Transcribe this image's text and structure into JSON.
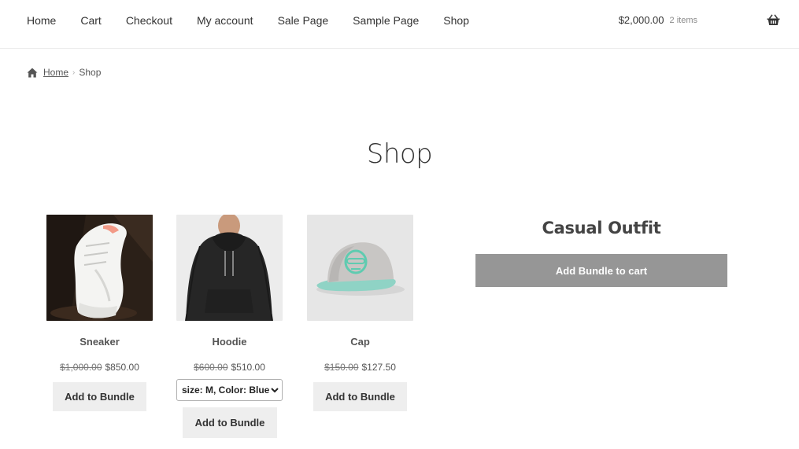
{
  "nav": {
    "items": [
      {
        "label": "Home"
      },
      {
        "label": "Cart"
      },
      {
        "label": "Checkout"
      },
      {
        "label": "My account"
      },
      {
        "label": "Sale Page"
      },
      {
        "label": "Sample Page"
      },
      {
        "label": "Shop"
      }
    ]
  },
  "cart": {
    "amount": "$2,000.00",
    "count": "2 items",
    "icon": "basket-icon"
  },
  "breadcrumb": {
    "home_icon": "home-icon",
    "home": "Home",
    "current": "Shop"
  },
  "page": {
    "title": "Shop"
  },
  "products": [
    {
      "name": "Sneaker",
      "regular_price": "$1,000.00",
      "sale_price": "$850.00",
      "button": "Add to Bundle"
    },
    {
      "name": "Hoodie",
      "regular_price": "$600.00",
      "sale_price": "$510.00",
      "variation": "size: M, Color: Blue",
      "button": "Add to Bundle"
    },
    {
      "name": "Cap",
      "regular_price": "$150.00",
      "sale_price": "$127.50",
      "button": "Add to Bundle"
    }
  ],
  "bundle": {
    "title": "Casual Outfit",
    "button": "Add Bundle to cart"
  }
}
